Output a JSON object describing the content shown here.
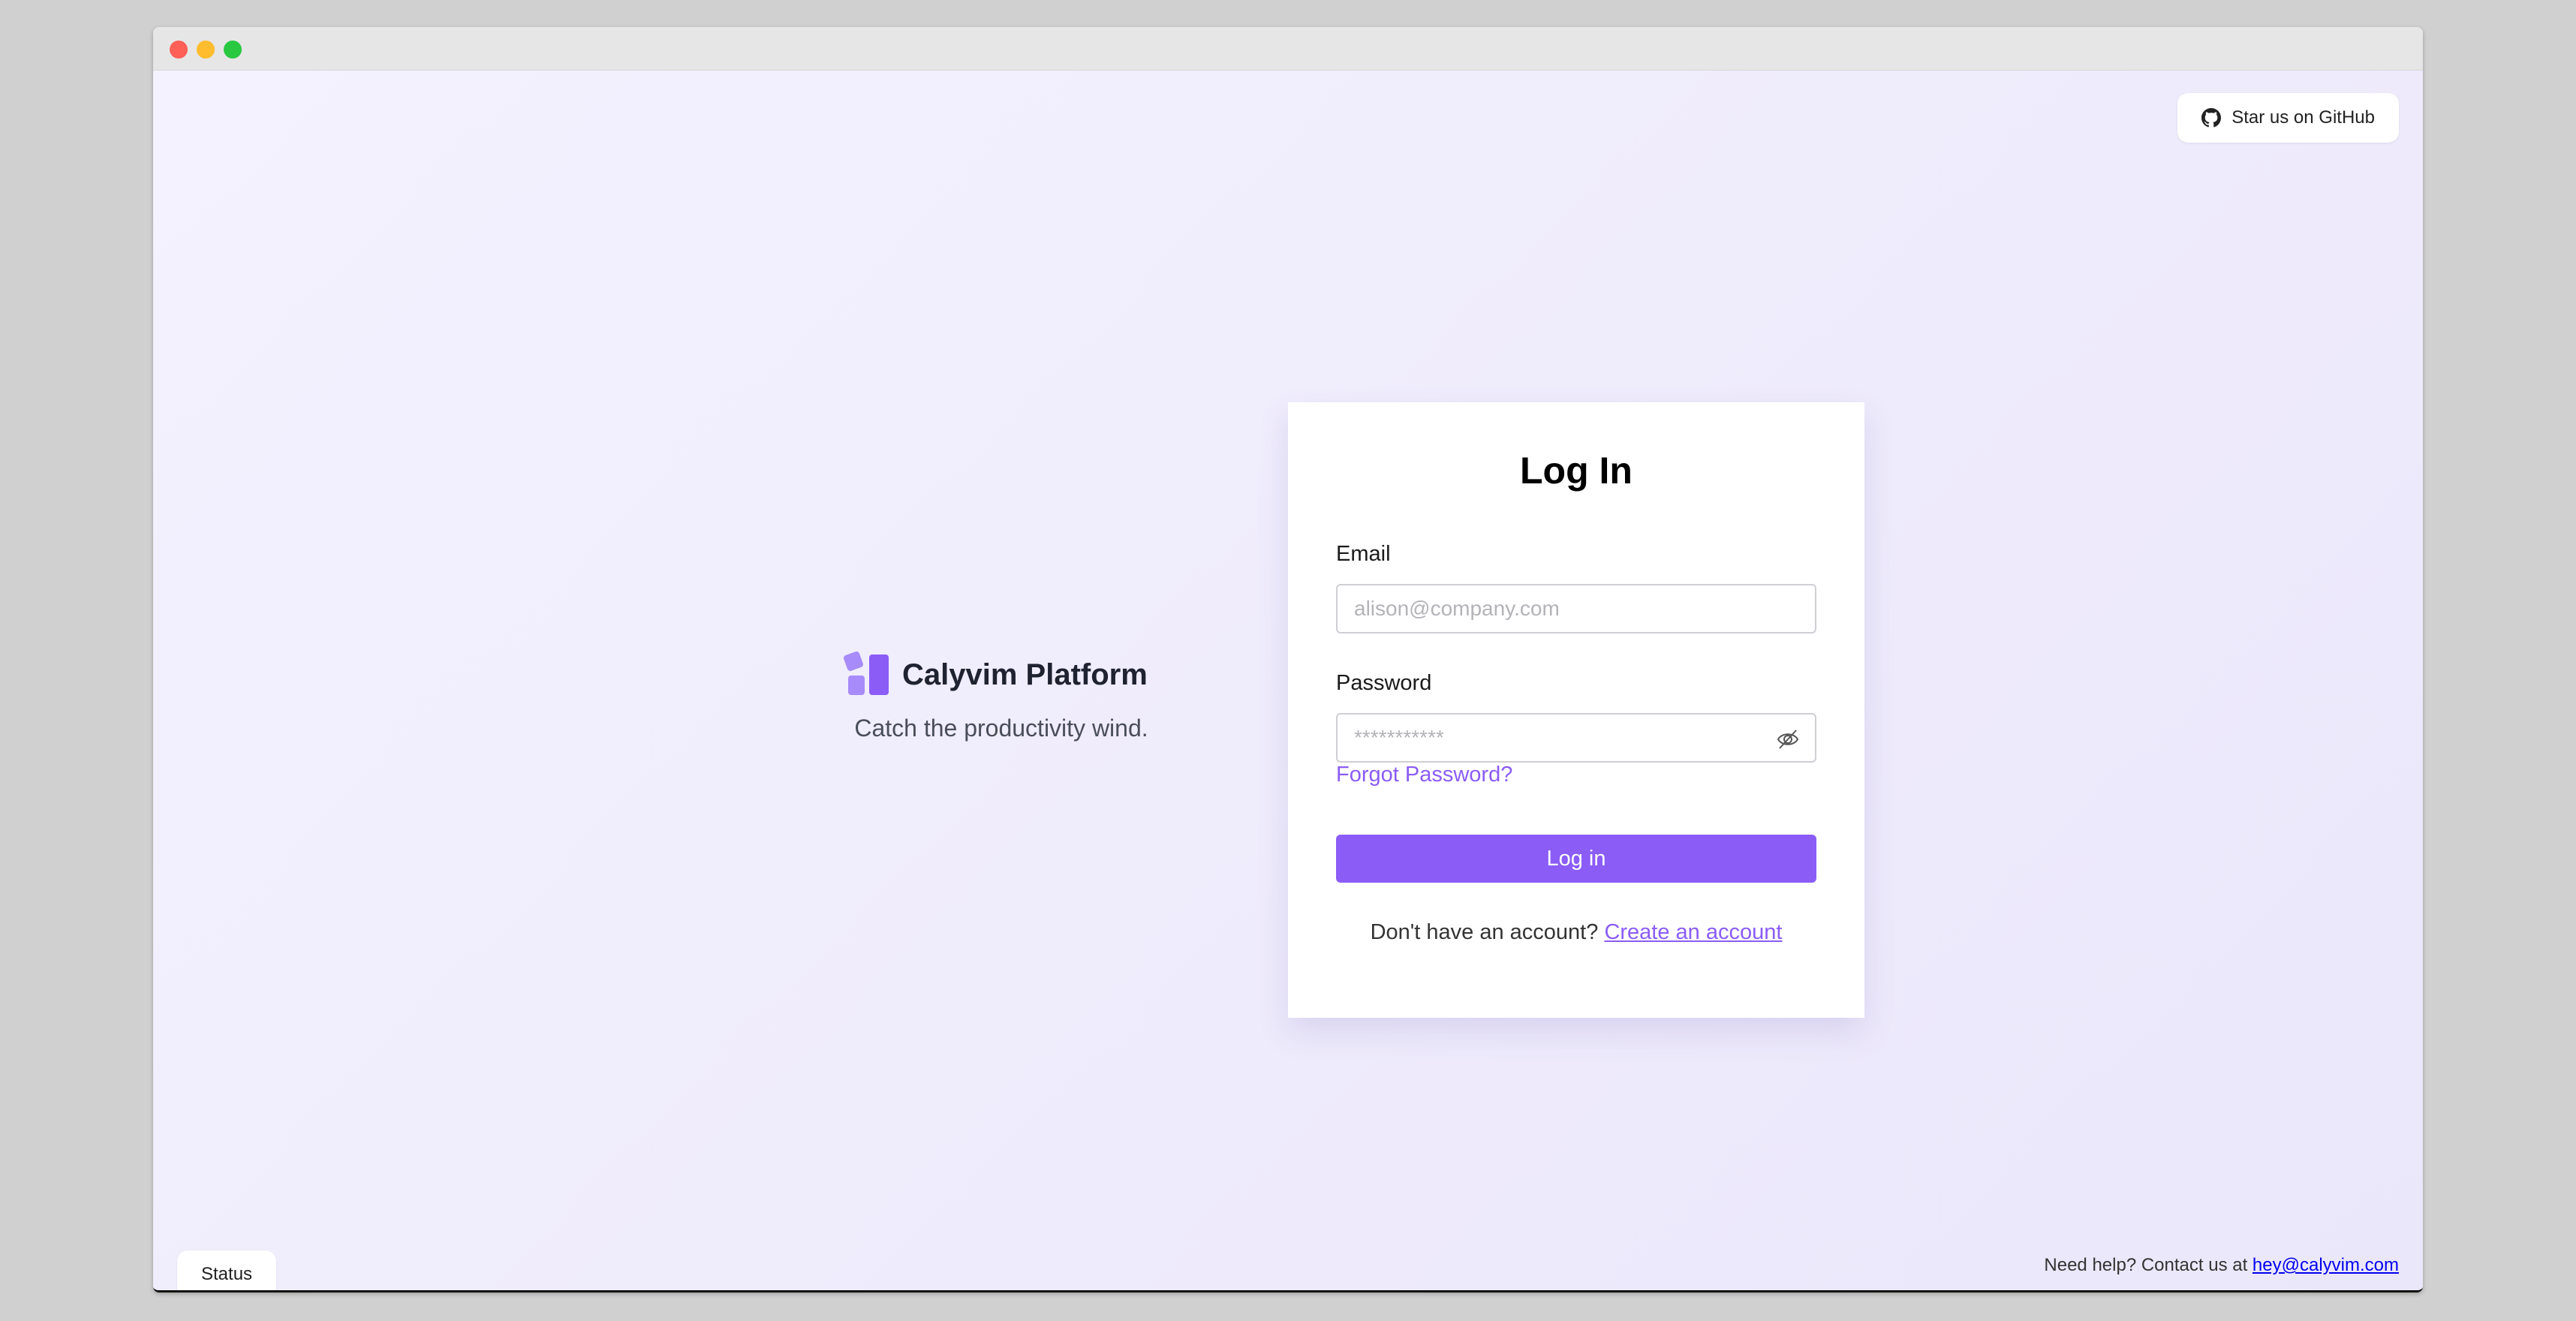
{
  "window": {
    "controls": [
      "close",
      "minimize",
      "maximize"
    ]
  },
  "header": {
    "github_label": "Star us on GitHub",
    "github_icon": "github-icon"
  },
  "brand": {
    "title": "Calyvim Platform",
    "tagline": "Catch the productivity wind.",
    "logo_color": "#8b5cf6"
  },
  "login": {
    "heading": "Log In",
    "email_label": "Email",
    "email_placeholder": "alison@company.com",
    "email_value": "",
    "password_label": "Password",
    "password_placeholder": "***********",
    "password_toggle_icon": "eye-off-icon",
    "forgot_label": "Forgot Password?",
    "submit_label": "Log in",
    "signup_prompt": "Don't have an account?",
    "signup_link": "Create an account"
  },
  "footer": {
    "status_label": "Status",
    "help_text": "Need help? Contact us at",
    "help_email": "hey@calyvim.com"
  },
  "colors": {
    "accent": "#8b5cf6",
    "background": "#f1effd"
  }
}
